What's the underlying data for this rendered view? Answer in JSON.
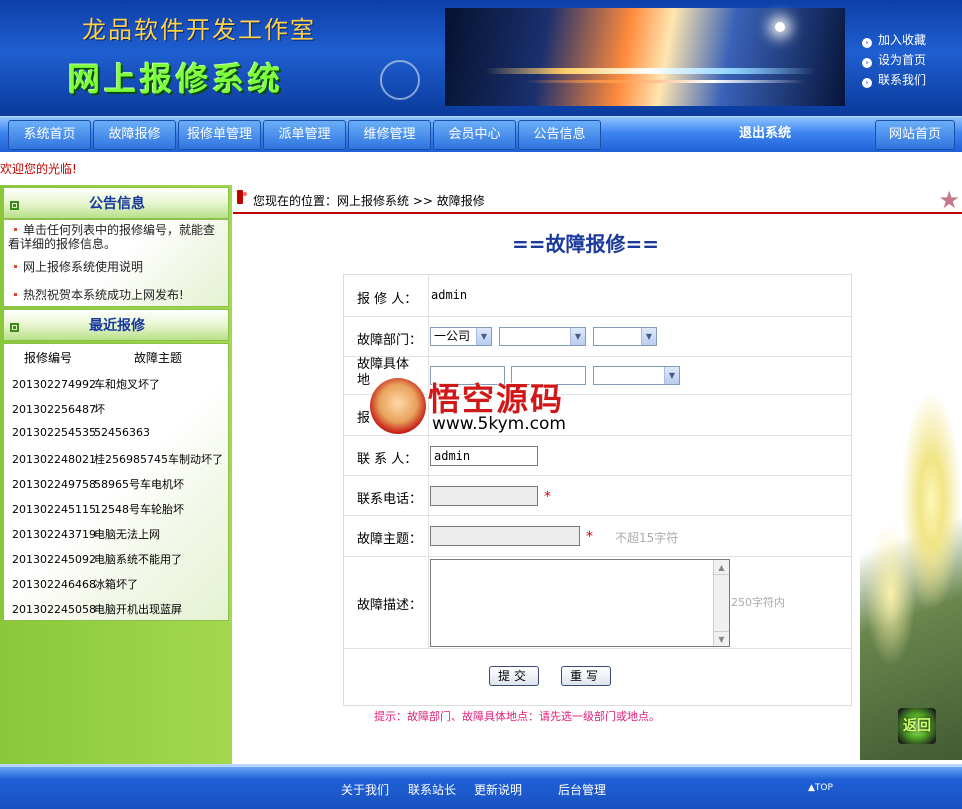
{
  "header": {
    "studio": "龙品软件开发工作室",
    "system": "网上报修系统",
    "links": [
      "加入收藏",
      "设为首页",
      "联系我们"
    ]
  },
  "nav": {
    "items": [
      "系统首页",
      "故障报修",
      "报修单管理",
      "派单管理",
      "维修管理",
      "会员中心",
      "公告信息"
    ],
    "logout": "退出系统",
    "site_home": "网站首页"
  },
  "welcome": "欢迎您的光临!",
  "sidebar": {
    "notice_title": "公告信息",
    "notices": [
      "单击任何列表中的报修编号，就能查看详细的报修信息。",
      "网上报修系统使用说明",
      "热烈祝贺本系统成功上网发布!"
    ],
    "recent_title": "最近报修",
    "col_code": "报修编号",
    "col_subject": "故障主题",
    "recent": [
      {
        "code": "201302274992",
        "subject": "车和炮叉坏了"
      },
      {
        "code": "201302256487",
        "subject": "坏"
      },
      {
        "code": "201302254535",
        "subject": "52456363"
      },
      {
        "code": "201302248021",
        "subject": "桂256985745车制动坏了"
      },
      {
        "code": "201302249758",
        "subject": "58965号车电机坏"
      },
      {
        "code": "201302245115",
        "subject": "12548号车轮胎坏"
      },
      {
        "code": "201302243719",
        "subject": "电脑无法上网"
      },
      {
        "code": "201302245092",
        "subject": "电脑系统不能用了"
      },
      {
        "code": "201302246468",
        "subject": "冰箱坏了"
      },
      {
        "code": "201302245058",
        "subject": "电脑开机出现蓝屏"
      }
    ]
  },
  "breadcrumb": "您现在的位置：网上报修系统 >> 故障报修",
  "page_title": "==故障报修==",
  "form": {
    "reporter_label": "报 修 人：",
    "reporter_value": "admin",
    "dept_label": "故障部门：",
    "dept_value": "一公司",
    "location_label": "故障具体地",
    "report_label": "报",
    "contact_label": "联 系 人：",
    "contact_value": "admin",
    "phone_label": "联系电话：",
    "subject_label": "故障主题：",
    "subject_hint": "不超15字符",
    "desc_label": "故障描述：",
    "desc_hint": "250字符内",
    "required_mark": "*",
    "submit": "提交",
    "reset": "重写"
  },
  "tip": "提示：故障部门、故障具体地点：请先选一级部门或地点。",
  "watermark": {
    "title": "悟空源码",
    "url": "www.5kym.com"
  },
  "back_button": "返回",
  "footer": {
    "links": [
      "关于我们",
      "联系站长",
      "更新说明",
      "后台管理"
    ],
    "top": "TOP"
  }
}
